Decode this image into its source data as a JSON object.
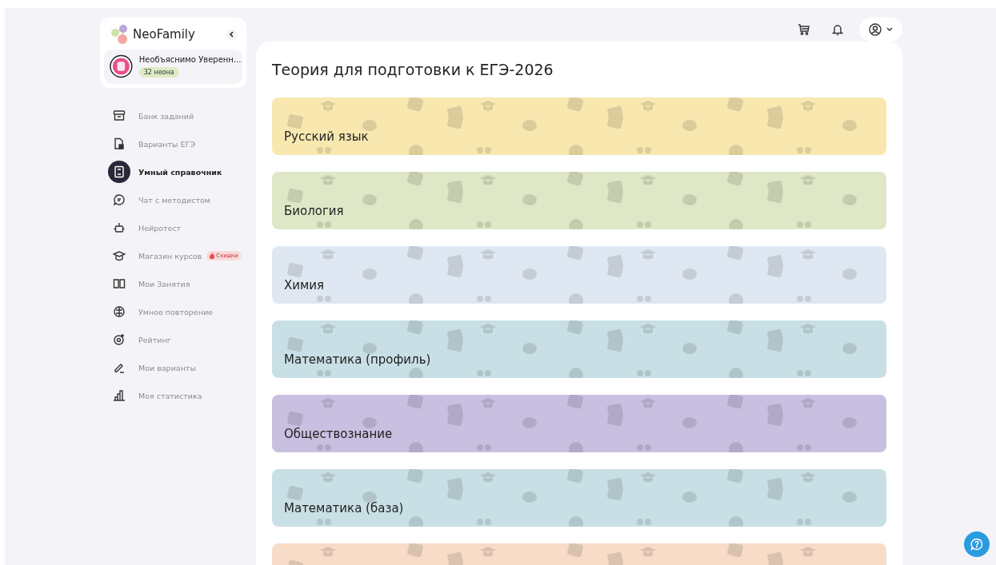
{
  "logo": {
    "text": "NeoFamily"
  },
  "user": {
    "name": "Необъяснимо Уверенн...",
    "badge": "32 неона"
  },
  "nav": [
    {
      "label": "Банк заданий",
      "selected": false
    },
    {
      "label": "Варианты ЕГЭ",
      "selected": false
    },
    {
      "label": "Умный справочник",
      "selected": true
    },
    {
      "label": "Чат с методистом",
      "selected": false
    },
    {
      "label": "Нейротест",
      "selected": false
    },
    {
      "label": "Магазин курсов",
      "selected": false,
      "tag": "Скидки"
    },
    {
      "label": "Мои Занятия",
      "selected": false
    },
    {
      "label": "Умное повторение",
      "selected": false
    },
    {
      "label": "Рейтинг",
      "selected": false
    },
    {
      "label": "Мои варианты",
      "selected": false
    },
    {
      "label": "Моя статистика",
      "selected": false
    }
  ],
  "page_title": "Теория для подготовки к ЕГЭ-2026",
  "subjects": [
    {
      "title": "Русский язык",
      "color": "#f8e8b0"
    },
    {
      "title": "Биология",
      "color": "#dfe8c6"
    },
    {
      "title": "Химия",
      "color": "#dfe8f2"
    },
    {
      "title": "Математика (профиль)",
      "color": "#c9dfe6"
    },
    {
      "title": "Обществознание",
      "color": "#c9bfe0"
    },
    {
      "title": "Математика (база)",
      "color": "#c9dfe6"
    },
    {
      "color": "#f8dcc8"
    }
  ]
}
